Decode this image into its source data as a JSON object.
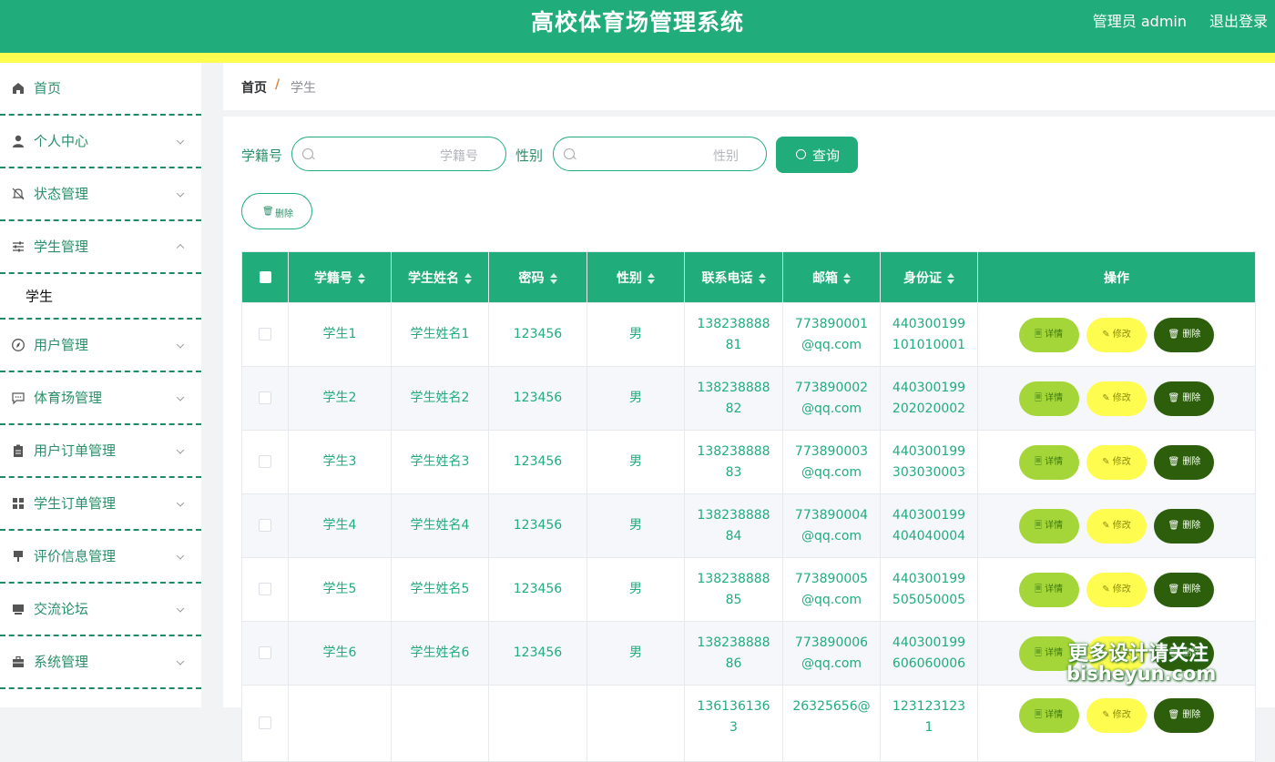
{
  "header": {
    "title": "高校体育场管理系统",
    "admin_label": "管理员 admin",
    "logout_label": "退出登录"
  },
  "sidebar": {
    "items": [
      {
        "label": "首页",
        "icon": "home-icon",
        "expandable": false
      },
      {
        "label": "个人中心",
        "icon": "user-icon",
        "expandable": true
      },
      {
        "label": "状态管理",
        "icon": "bell-off-icon",
        "expandable": true
      },
      {
        "label": "学生管理",
        "icon": "sliders-icon",
        "expandable": true,
        "expanded": true
      },
      {
        "label": "用户管理",
        "icon": "compass-icon",
        "expandable": true
      },
      {
        "label": "体育场管理",
        "icon": "chat-icon",
        "expandable": true
      },
      {
        "label": "用户订单管理",
        "icon": "clipboard-icon",
        "expandable": true
      },
      {
        "label": "学生订单管理",
        "icon": "grid-icon",
        "expandable": true
      },
      {
        "label": "评价信息管理",
        "icon": "stamp-icon",
        "expandable": true
      },
      {
        "label": "交流论坛",
        "icon": "monitor-icon",
        "expandable": true
      },
      {
        "label": "系统管理",
        "icon": "briefcase-icon",
        "expandable": true
      }
    ],
    "submenu_label": "学生"
  },
  "breadcrumb": {
    "home": "首页",
    "separator": "/",
    "current": "学生"
  },
  "filters": {
    "student_id_label": "学籍号",
    "student_id_placeholder": "学籍号",
    "gender_label": "性别",
    "gender_placeholder": "性别",
    "query_button": "查询",
    "delete_button": "删除"
  },
  "table": {
    "columns": [
      "学籍号",
      "学生姓名",
      "密码",
      "性别",
      "联系电话",
      "邮箱",
      "身份证",
      "操作"
    ],
    "actions": {
      "detail": "详情",
      "edit": "修改",
      "delete": "删除"
    },
    "rows": [
      {
        "id": "学生1",
        "name": "学生姓名1",
        "password": "123456",
        "gender": "男",
        "phone": "13823888881",
        "email": "773890001@qq.com",
        "idcard": "440300199101010001"
      },
      {
        "id": "学生2",
        "name": "学生姓名2",
        "password": "123456",
        "gender": "男",
        "phone": "13823888882",
        "email": "773890002@qq.com",
        "idcard": "440300199202020002"
      },
      {
        "id": "学生3",
        "name": "学生姓名3",
        "password": "123456",
        "gender": "男",
        "phone": "13823888883",
        "email": "773890003@qq.com",
        "idcard": "440300199303030003"
      },
      {
        "id": "学生4",
        "name": "学生姓名4",
        "password": "123456",
        "gender": "男",
        "phone": "13823888884",
        "email": "773890004@qq.com",
        "idcard": "440300199404040004"
      },
      {
        "id": "学生5",
        "name": "学生姓名5",
        "password": "123456",
        "gender": "男",
        "phone": "13823888885",
        "email": "773890005@qq.com",
        "idcard": "440300199505050005"
      },
      {
        "id": "学生6",
        "name": "学生姓名6",
        "password": "123456",
        "gender": "男",
        "phone": "13823888886",
        "email": "773890006@qq.com",
        "idcard": "440300199606060006"
      },
      {
        "id": "",
        "name": "",
        "password": "",
        "gender": "",
        "phone": "1361361363",
        "email": "26325656@",
        "idcard": "1231231231"
      }
    ]
  },
  "watermark": {
    "line1": "更多设计请关注",
    "line2": "bisheyun.com"
  },
  "colors": {
    "primary": "#21ac7c",
    "stripe": "#fdfc4f",
    "detail_button": "#a5d639",
    "edit_button": "#fdfc4f",
    "delete_button": "#2c5e0c"
  }
}
